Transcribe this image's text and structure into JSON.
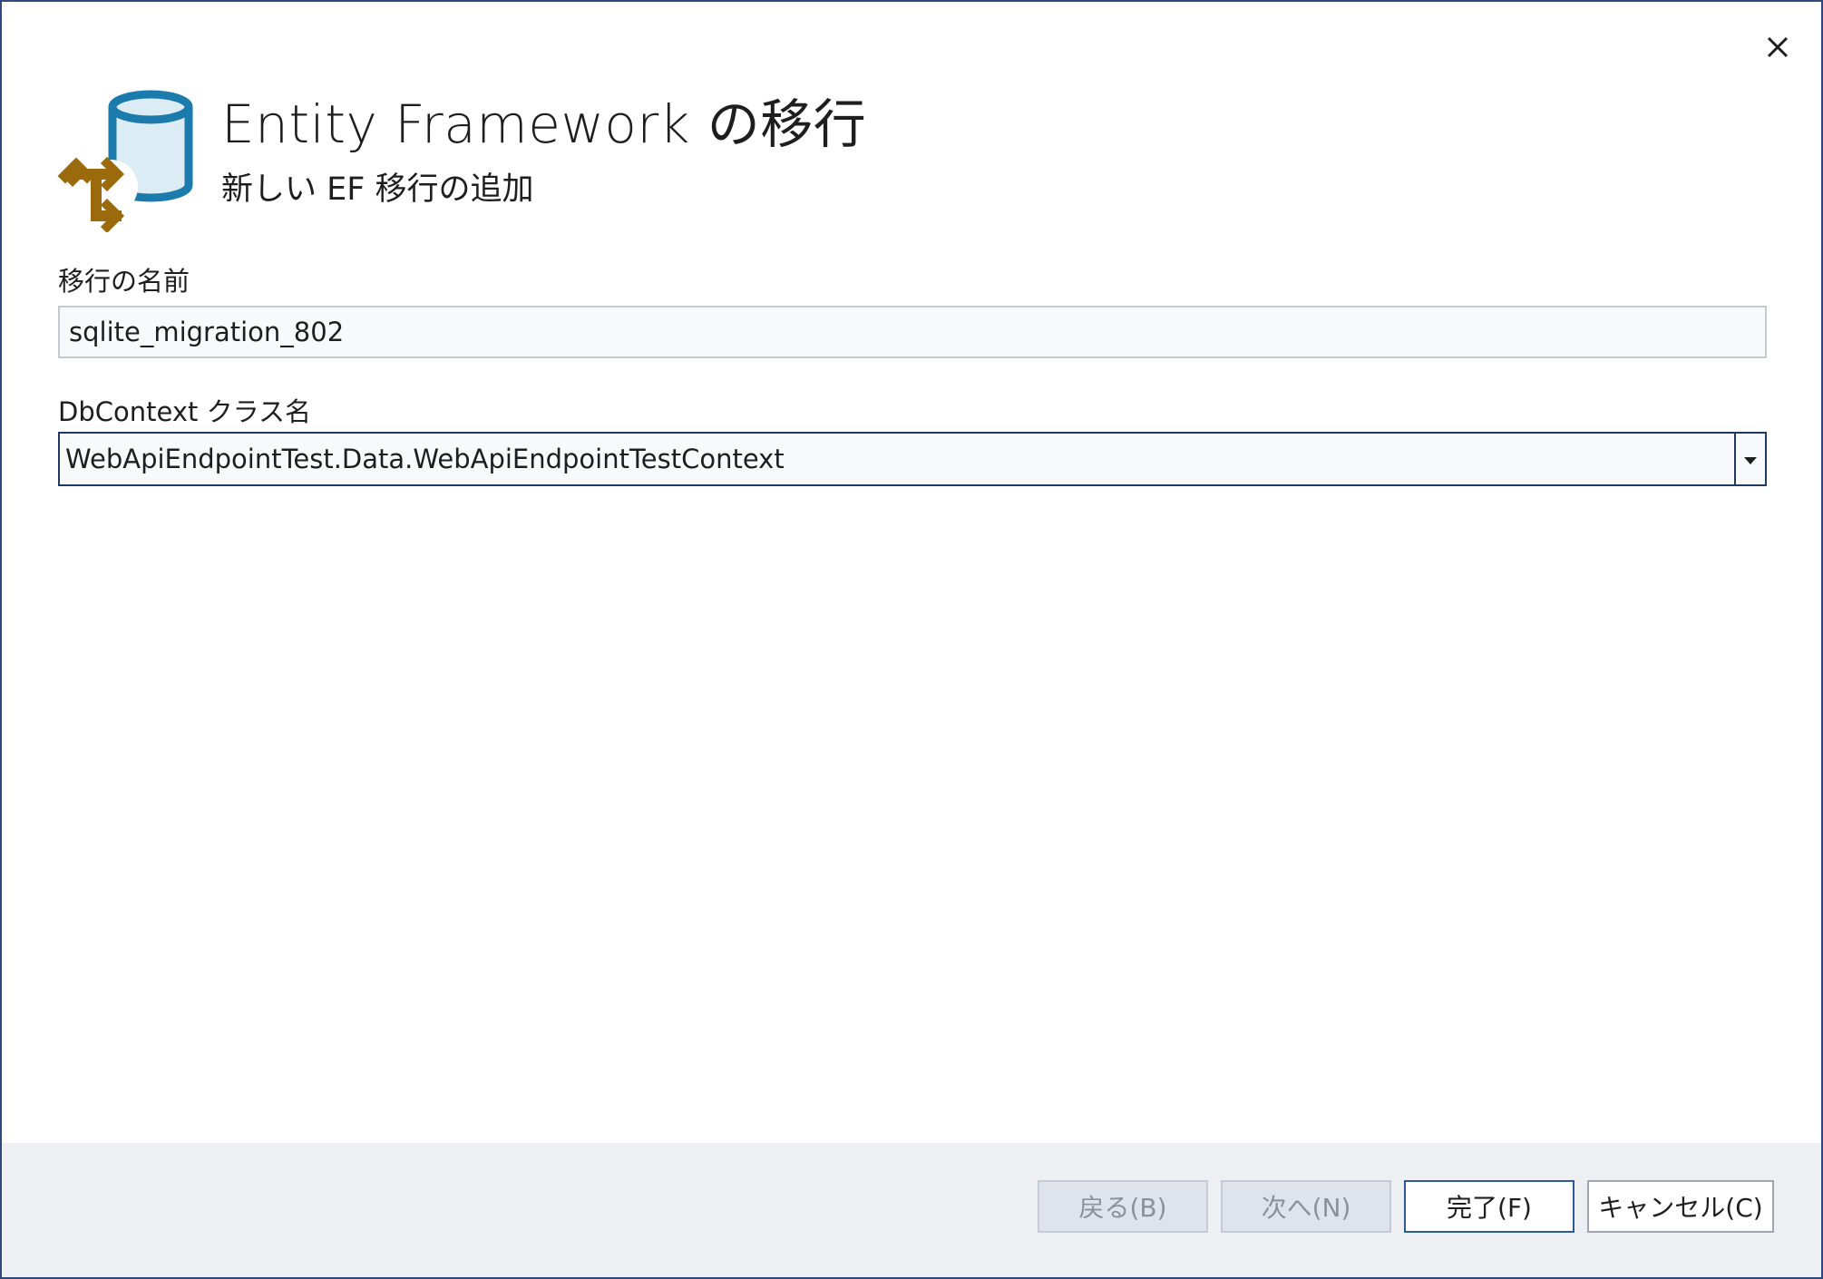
{
  "dialog": {
    "title": "Entity Framework の移行",
    "subtitle": "新しい EF 移行の追加",
    "close_icon": "close-icon",
    "logo_icon": "ef-database-migration-icon"
  },
  "form": {
    "migration_name_label": "移行の名前",
    "migration_name_value": "sqlite_migration_802",
    "dbcontext_label": "DbContext クラス名",
    "dbcontext_value": "WebApiEndpointTest.Data.WebApiEndpointTestContext",
    "dbcontext_dropdown_icon": "chevron-down-icon"
  },
  "footer": {
    "back_label": "戻る(B)",
    "next_label": "次へ(N)",
    "finish_label": "完了(F)",
    "cancel_label": "キャンセル(C)"
  },
  "colors": {
    "accent": "#1f3a64",
    "logo_blue": "#1c7bad",
    "logo_fill": "#dcecf4",
    "logo_brown": "#9b6a0d",
    "footer_bg": "#eeeff2"
  }
}
